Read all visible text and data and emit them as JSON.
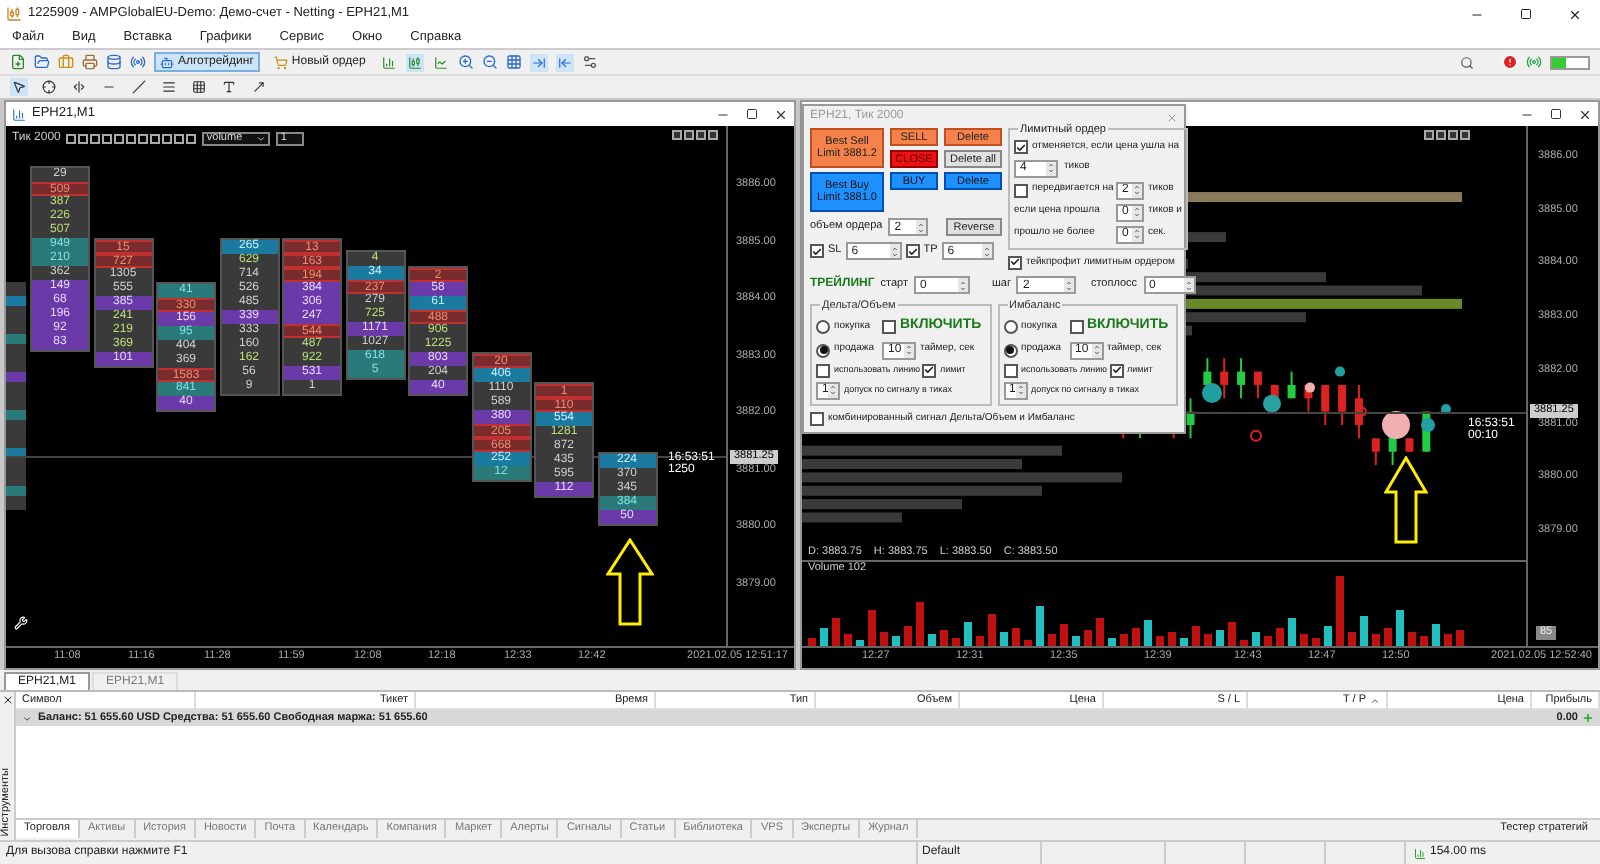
{
  "window": {
    "title": "1225909 - AMPGlobalEU-Demo: Демо-счет - Netting - EPH21,M1"
  },
  "menu": [
    "Файл",
    "Вид",
    "Вставка",
    "Графики",
    "Сервис",
    "Окно",
    "Справка"
  ],
  "toolbar": {
    "buttons": [
      {
        "label": "Алготрейдинг",
        "selected": true
      },
      {
        "label": "Новый ордер",
        "selected": false
      }
    ],
    "chart_types": [
      {
        "kind": "bars",
        "selected": false
      },
      {
        "kind": "candles",
        "selected": true
      },
      {
        "kind": "line",
        "selected": false
      }
    ],
    "scroll": [
      {
        "kind": "autoscroll",
        "selected": true
      },
      {
        "kind": "shift",
        "selected": true
      }
    ]
  },
  "tools": [
    {
      "kind": "cursor",
      "selected": true
    },
    {
      "kind": "crosshair",
      "selected": false
    },
    {
      "kind": "vline",
      "selected": false
    },
    {
      "kind": "hline",
      "selected": false
    },
    {
      "kind": "trend",
      "selected": false
    },
    {
      "kind": "fibo",
      "selected": false
    },
    {
      "kind": "channels",
      "selected": false
    },
    {
      "kind": "text",
      "selected": false
    },
    {
      "kind": "arrows",
      "selected": false
    }
  ],
  "left_chart": {
    "title": "EPH21,M1",
    "timeframe": "Тик 2000",
    "mode": "volume",
    "step": "1",
    "columns": [
      {
        "cells": [
          {
            "value": "29",
            "kind": "plain"
          },
          {
            "value": "509",
            "kind": "red"
          },
          {
            "value": "387",
            "kind": "green"
          },
          {
            "value": "226",
            "kind": "green"
          },
          {
            "value": "507",
            "kind": "green"
          },
          {
            "value": "949",
            "kind": "teal"
          },
          {
            "value": "210",
            "kind": "teal"
          },
          {
            "value": "362",
            "kind": "plain"
          },
          {
            "value": "149",
            "kind": "purple"
          },
          {
            "value": "68",
            "kind": "purple"
          },
          {
            "value": "196",
            "kind": "purple"
          },
          {
            "value": "92",
            "kind": "purple"
          },
          {
            "value": "83",
            "kind": "purple"
          }
        ]
      },
      {
        "cells": [
          {
            "value": "15",
            "kind": "red"
          },
          {
            "value": "727",
            "kind": "red"
          },
          {
            "value": "1305",
            "kind": "plain"
          },
          {
            "value": "555",
            "kind": "plain"
          },
          {
            "value": "385",
            "kind": "purple"
          },
          {
            "value": "241",
            "kind": "green"
          },
          {
            "value": "219",
            "kind": "green"
          },
          {
            "value": "369",
            "kind": "green"
          },
          {
            "value": "101",
            "kind": "purple"
          }
        ]
      },
      {
        "cells": [
          {
            "value": "41",
            "kind": "teal"
          },
          {
            "value": "330",
            "kind": "red"
          },
          {
            "value": "156",
            "kind": "purple"
          },
          {
            "value": "95",
            "kind": "teal"
          },
          {
            "value": "404",
            "kind": "plain"
          },
          {
            "value": "369",
            "kind": "plain"
          },
          {
            "value": "1583",
            "kind": "red"
          },
          {
            "value": "841",
            "kind": "teal"
          },
          {
            "value": "40",
            "kind": "purple"
          }
        ]
      },
      {
        "cells": [
          {
            "value": "265",
            "kind": "blue"
          },
          {
            "value": "629",
            "kind": "green"
          },
          {
            "value": "714",
            "kind": "plain"
          },
          {
            "value": "526",
            "kind": "plain"
          },
          {
            "value": "485",
            "kind": "plain"
          },
          {
            "value": "339",
            "kind": "purple"
          },
          {
            "value": "333",
            "kind": "plain"
          },
          {
            "value": "160",
            "kind": "plain"
          },
          {
            "value": "162",
            "kind": "green"
          },
          {
            "value": "56",
            "kind": "plain"
          },
          {
            "value": "9",
            "kind": "plain"
          }
        ]
      },
      {
        "cells": [
          {
            "value": "13",
            "kind": "red"
          },
          {
            "value": "163",
            "kind": "red"
          },
          {
            "value": "194",
            "kind": "red"
          },
          {
            "value": "384",
            "kind": "purple"
          },
          {
            "value": "306",
            "kind": "purple"
          },
          {
            "value": "247",
            "kind": "purple"
          },
          {
            "value": "544",
            "kind": "red"
          },
          {
            "value": "487",
            "kind": "green"
          },
          {
            "value": "922",
            "kind": "green"
          },
          {
            "value": "531",
            "kind": "purple"
          },
          {
            "value": "1",
            "kind": "plain"
          }
        ]
      },
      {
        "cells": [
          {
            "value": "4",
            "kind": "green"
          },
          {
            "value": "34",
            "kind": "blue"
          },
          {
            "value": "237",
            "kind": "red"
          },
          {
            "value": "279",
            "kind": "plain"
          },
          {
            "value": "725",
            "kind": "green"
          },
          {
            "value": "1171",
            "kind": "purple"
          },
          {
            "value": "1027",
            "kind": "plain"
          },
          {
            "value": "618",
            "kind": "teal"
          },
          {
            "value": "5",
            "kind": "teal"
          }
        ]
      },
      {
        "cells": [
          {
            "value": "2",
            "kind": "red"
          },
          {
            "value": "58",
            "kind": "purple"
          },
          {
            "value": "61",
            "kind": "blue"
          },
          {
            "value": "488",
            "kind": "red"
          },
          {
            "value": "906",
            "kind": "green"
          },
          {
            "value": "1225",
            "kind": "green"
          },
          {
            "value": "803",
            "kind": "purple"
          },
          {
            "value": "204",
            "kind": "plain"
          },
          {
            "value": "40",
            "kind": "purple"
          }
        ]
      },
      {
        "cells": [
          {
            "value": "20",
            "kind": "red"
          },
          {
            "value": "406",
            "kind": "blue"
          },
          {
            "value": "1110",
            "kind": "plain"
          },
          {
            "value": "589",
            "kind": "plain"
          },
          {
            "value": "380",
            "kind": "purple"
          },
          {
            "value": "205",
            "kind": "red"
          },
          {
            "value": "668",
            "kind": "red"
          },
          {
            "value": "252",
            "kind": "blue"
          },
          {
            "value": "12",
            "kind": "teal"
          }
        ]
      },
      {
        "cells": [
          {
            "value": "1",
            "kind": "red"
          },
          {
            "value": "110",
            "kind": "red"
          },
          {
            "value": "554",
            "kind": "blue"
          },
          {
            "value": "1281",
            "kind": "green"
          },
          {
            "value": "872",
            "kind": "plain"
          },
          {
            "value": "435",
            "kind": "plain"
          },
          {
            "value": "595",
            "kind": "plain"
          },
          {
            "value": "112",
            "kind": "purple"
          }
        ]
      },
      {
        "cells": [
          {
            "value": "224",
            "kind": "blue"
          },
          {
            "value": "370",
            "kind": "plain"
          },
          {
            "value": "345",
            "kind": "plain"
          },
          {
            "value": "384",
            "kind": "teal"
          },
          {
            "value": "50",
            "kind": "purple"
          }
        ]
      }
    ],
    "price_labels": [
      "3886.00",
      "3885.00",
      "3884.00",
      "3883.00",
      "3882.00",
      "3881.00",
      "3880.00",
      "3879.00"
    ],
    "current_price": "3881.25",
    "timer": "16:53:51",
    "tick_volume": "1250",
    "time_labels": [
      "11:08",
      "11:16",
      "11:28",
      "11:59",
      "12:08",
      "12:18",
      "12:33",
      "12:42"
    ],
    "date_label": "2021.02.05 12:51:17"
  },
  "right_chart": {
    "price_labels": [
      "3886.00",
      "3885.00",
      "3884.00",
      "3883.00",
      "3882.00",
      "3881.00",
      "3880.00",
      "3879.00"
    ],
    "current_price": "3881.25",
    "timer": "16:53:51",
    "countdown": "00:10",
    "ohlc": [
      "D: 3883.75",
      "H: 3883.75",
      "L: 3883.50",
      "C: 3883.50"
    ],
    "volume_label": "Volume 102",
    "volume_axis_label": "85",
    "time_labels": [
      "12:27",
      "12:31",
      "12:35",
      "12:39",
      "12:43",
      "12:47",
      "12:50"
    ],
    "date_label": "2021.02.05 12:52:40"
  },
  "panel": {
    "title": "EPH21, Тик 2000",
    "buttons": [
      {
        "label": "Best Sell Limit 3881.2",
        "kind": "limit_sell"
      },
      {
        "label": "SELL",
        "kind": "sell"
      },
      {
        "label": "Delete",
        "kind": "sell"
      },
      {
        "label": "CLOSE",
        "kind": "close"
      },
      {
        "label": "Delete all",
        "kind": "neutral"
      },
      {
        "label": "Best Buy Limit 3881.0",
        "kind": "limit_buy"
      },
      {
        "label": "BUY",
        "kind": "buy"
      },
      {
        "label": "Delete",
        "kind": "buy"
      }
    ],
    "volume": {
      "label": "объем ордера",
      "value": "2"
    },
    "reverse": "Reverse",
    "sl": {
      "label": "SL",
      "checked": true,
      "value": "6"
    },
    "tp": {
      "label": "TP",
      "checked": true,
      "value": "6"
    },
    "trailing": {
      "title": "ТРЕЙЛИНГ",
      "start_label": "старт",
      "start": "0",
      "step_label": "шаг",
      "step": "2",
      "stop_label": "стоплосс",
      "stop": "0"
    },
    "limit_order": {
      "title": "Лимитный ордер",
      "cancel": {
        "checked": true,
        "label": "отменяется, если цена ушла на",
        "value": "4",
        "unit": "тиков"
      },
      "move": {
        "checked": false,
        "label": "передвигается на",
        "value": "2",
        "unit": "тиков"
      },
      "if_passed": {
        "label": "если цена прошла",
        "value": "0",
        "unit": "тиков и"
      },
      "elapsed": {
        "label": "прошло не более",
        "value": "0",
        "unit": "сек."
      }
    },
    "takeprofit_limit": {
      "checked": true,
      "label": "тейкпрофит лимитным ордером"
    },
    "signals": [
      {
        "title": "Дельта/Объем",
        "modes": [
          {
            "label": "покупка",
            "selected": false
          },
          {
            "label": "продажа",
            "selected": true
          }
        ],
        "enable": {
          "label": "ВКЛЮЧИТЬ",
          "checked": false
        },
        "timer": "10",
        "timer_label": "таймер, сек",
        "use_line": {
          "label": "использовать линию",
          "checked": false
        },
        "limit": {
          "label": "лимит",
          "checked": true
        },
        "tolerance": "1",
        "tolerance_label": "допуск по сигналу в тиках"
      },
      {
        "title": "Имбаланс",
        "modes": [
          {
            "label": "покупка",
            "selected": false
          },
          {
            "label": "продажа",
            "selected": true
          }
        ],
        "enable": {
          "label": "ВКЛЮЧИТЬ",
          "checked": false
        },
        "timer": "10",
        "timer_label": "таймер, сек",
        "use_line": {
          "label": "использовать линию",
          "checked": false
        },
        "limit": {
          "label": "лимит",
          "checked": true
        },
        "tolerance": "1",
        "tolerance_label": "допуск по сигналу в тиках"
      }
    ],
    "combined": {
      "checked": false,
      "label": "комбинированный сигнал Дельта/Объем и Имбаланс"
    }
  },
  "chart_tabs": [
    {
      "label": "EPH21,M1",
      "selected": true
    },
    {
      "label": "EPH21,M1",
      "selected": false
    }
  ],
  "terminal": {
    "side_label": "Инструменты",
    "columns": [
      "Символ",
      "Тикет",
      "Время",
      "Тип",
      "Объем",
      "Цена",
      "S / L",
      "T / P",
      "Цена",
      "Прибыль"
    ],
    "balance": "Баланс: 51 655.60 USD  Средства: 51 655.60  Свободная маржа: 51 655.60",
    "profit": "0.00",
    "tabs": [
      {
        "label": "Торговля",
        "selected": true
      },
      {
        "label": "Активы",
        "selected": false
      },
      {
        "label": "История",
        "selected": false
      },
      {
        "label": "Новости",
        "selected": false
      },
      {
        "label": "Почта",
        "selected": false
      },
      {
        "label": "Календарь",
        "selected": false
      },
      {
        "label": "Компания",
        "selected": false
      },
      {
        "label": "Маркет",
        "selected": false
      },
      {
        "label": "Алерты",
        "selected": false
      },
      {
        "label": "Сигналы",
        "selected": false
      },
      {
        "label": "Статьи",
        "selected": false
      },
      {
        "label": "Библиотека",
        "selected": false
      },
      {
        "label": "VPS",
        "selected": false
      },
      {
        "label": "Эксперты",
        "selected": false
      },
      {
        "label": "Журнал",
        "selected": false
      }
    ],
    "tester": "Тестер стратегий"
  },
  "status_bar": {
    "help": "Для вызова справки нажмите F1",
    "profile": "Default",
    "ping": "154.00 ms"
  }
}
